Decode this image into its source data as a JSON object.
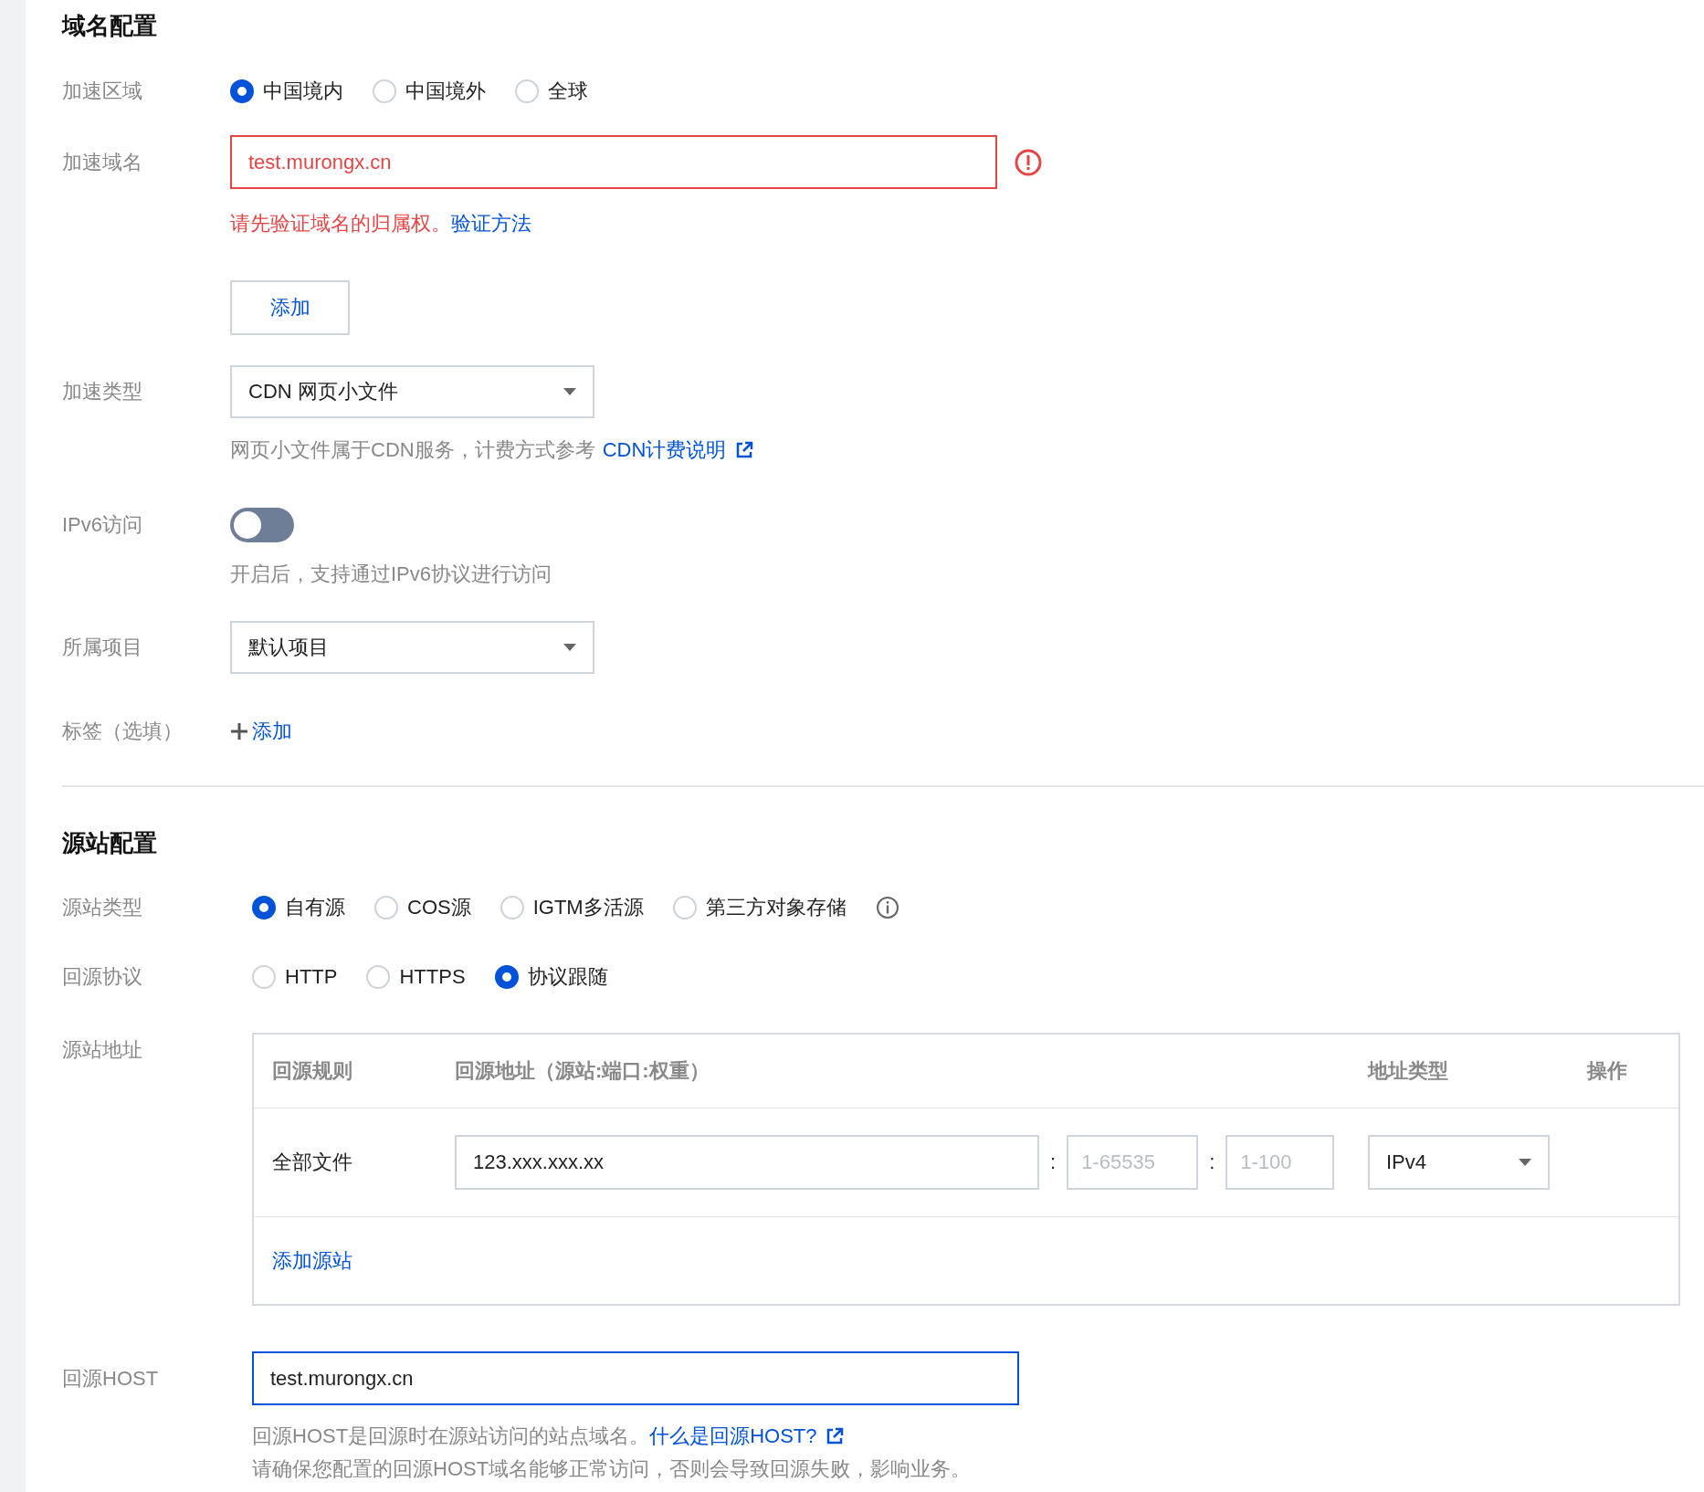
{
  "domain_config": {
    "title": "域名配置",
    "region": {
      "label": "加速区域",
      "options": [
        {
          "label": "中国境内",
          "selected": true
        },
        {
          "label": "中国境外",
          "selected": false
        },
        {
          "label": "全球",
          "selected": false
        }
      ]
    },
    "domain": {
      "label": "加速域名",
      "value": "test.murongx.cn",
      "invalid": true,
      "error_text": "请先验证域名的归属权。",
      "error_link": "验证方法",
      "add_button": "添加"
    },
    "type": {
      "label": "加速类型",
      "value": "CDN 网页小文件",
      "hint": "网页小文件属于CDN服务，计费方式参考",
      "hint_link": "CDN计费说明"
    },
    "ipv6": {
      "label": "IPv6访问",
      "on": false,
      "hint": "开启后，支持通过IPv6协议进行访问"
    },
    "project": {
      "label": "所属项目",
      "value": "默认项目"
    },
    "tags": {
      "label": "标签（选填）",
      "add_link": "添加"
    }
  },
  "origin_config": {
    "title": "源站配置",
    "origin_type": {
      "label": "源站类型",
      "options": [
        {
          "label": "自有源",
          "selected": true
        },
        {
          "label": "COS源",
          "selected": false
        },
        {
          "label": "IGTM多活源",
          "selected": false
        },
        {
          "label": "第三方对象存储",
          "selected": false
        }
      ]
    },
    "protocol": {
      "label": "回源协议",
      "options": [
        {
          "label": "HTTP",
          "selected": false
        },
        {
          "label": "HTTPS",
          "selected": false
        },
        {
          "label": "协议跟随",
          "selected": true
        }
      ]
    },
    "address": {
      "label": "源站地址",
      "columns": [
        "回源规则",
        "回源地址（源站:端口:权重）",
        "地址类型",
        "操作"
      ],
      "rows": [
        {
          "rule": "全部文件",
          "address": "123.xxx.xxx.xx",
          "separator_1": ":",
          "port_placeholder": "1-65535",
          "separator_2": ":",
          "weight_placeholder": "1-100",
          "address_type": "IPv4"
        }
      ],
      "add_link": "添加源站"
    },
    "host": {
      "label": "回源HOST",
      "value": "test.murongx.cn",
      "focused": true,
      "hint": "回源HOST是回源时在源站访问的站点域名。",
      "hint_link": "什么是回源HOST?",
      "note": "请确保您配置的回源HOST域名能够正常访问，否则会导致回源失败，影响业务。"
    }
  }
}
